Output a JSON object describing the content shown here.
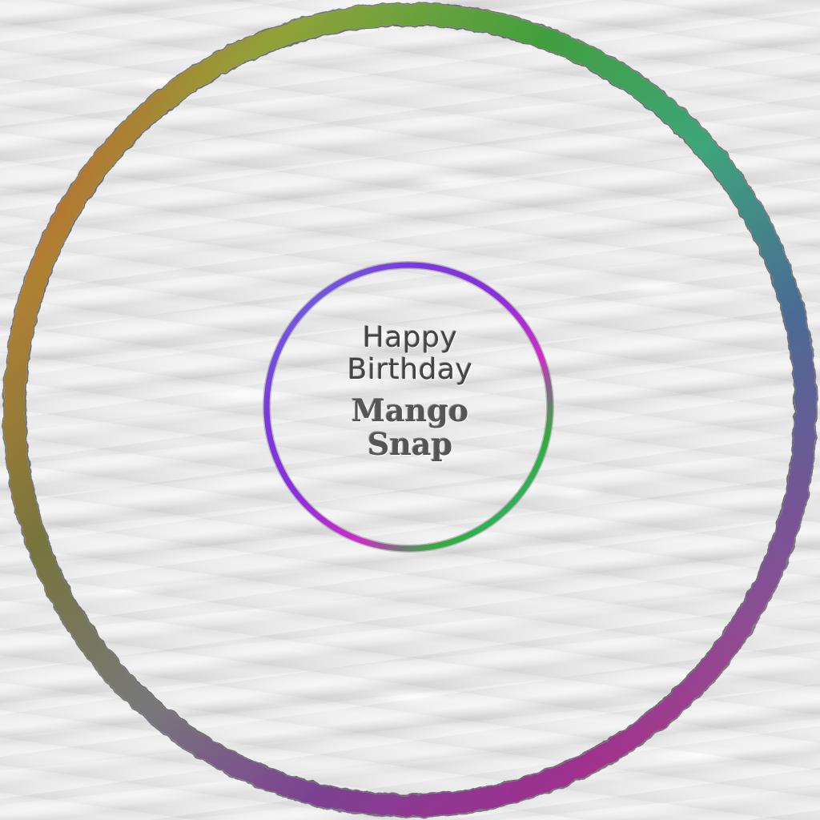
{
  "card": {
    "greeting_line1": "Happy",
    "greeting_line2": "Birthday",
    "name_line1": "Mango",
    "name_line2": "Snap"
  },
  "rings": [
    {
      "name": "outer-ring",
      "style": "rainbow"
    },
    {
      "name": "inner-ring",
      "style": "rainbow"
    }
  ],
  "colors": {
    "background": "#ebebeb",
    "text": "#444444",
    "ring_red": "#e0302a",
    "ring_green": "#2fae3a",
    "ring_teal": "#2fb7a8",
    "ring_blue": "#3a52d8",
    "ring_purple": "#7a2de0",
    "ring_magenta": "#e02cc8"
  }
}
